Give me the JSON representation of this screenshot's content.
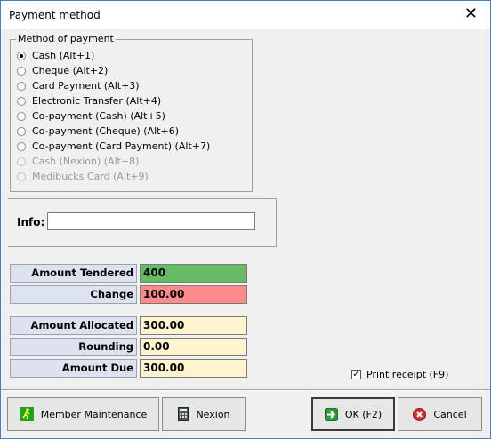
{
  "window": {
    "title": "Payment method"
  },
  "method_group": {
    "legend": "Method of payment",
    "options": [
      {
        "label": "Cash (Alt+1)",
        "selected": true,
        "enabled": true
      },
      {
        "label": "Cheque (Alt+2)",
        "selected": false,
        "enabled": true
      },
      {
        "label": "Card Payment (Alt+3)",
        "selected": false,
        "enabled": true
      },
      {
        "label": "Electronic Transfer (Alt+4)",
        "selected": false,
        "enabled": true
      },
      {
        "label": "Co-payment (Cash) (Alt+5)",
        "selected": false,
        "enabled": true
      },
      {
        "label": "Co-payment (Cheque) (Alt+6)",
        "selected": false,
        "enabled": true
      },
      {
        "label": "Co-payment (Card Payment) (Alt+7)",
        "selected": false,
        "enabled": true
      },
      {
        "label": "Cash (Nexion) (Alt+8)",
        "selected": false,
        "enabled": false
      },
      {
        "label": "Medibucks Card (Alt+9)",
        "selected": false,
        "enabled": false
      }
    ]
  },
  "info": {
    "label": "Info:",
    "value": ""
  },
  "amounts": {
    "tendered_label": "Amount Tendered",
    "tendered_value": "400",
    "change_label": "Change",
    "change_value": "100.00",
    "allocated_label": "Amount Allocated",
    "allocated_value": "300.00",
    "rounding_label": "Rounding",
    "rounding_value": "0.00",
    "due_label": "Amount Due",
    "due_value": "300.00"
  },
  "colors": {
    "tendered_bg": "#66bb66",
    "change_bg": "#ff8a8a",
    "readonly_bg": "#fff4cf",
    "label_bg": "#dde3ee"
  },
  "print_receipt": {
    "label": "Print receipt (F9)",
    "checked": true
  },
  "buttons": {
    "member_maintenance": "Member Maintenance",
    "nexion": "Nexion",
    "ok": "OK (F2)",
    "cancel": "Cancel"
  },
  "icons": {
    "member": "running-man-icon",
    "nexion": "calculator-icon",
    "ok": "arrow-right-icon",
    "cancel": "cancel-icon"
  }
}
